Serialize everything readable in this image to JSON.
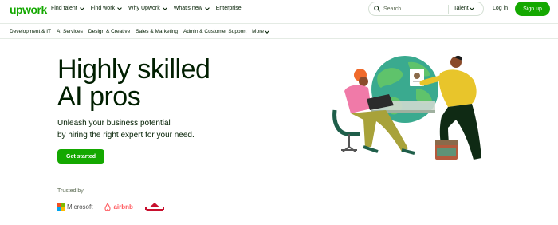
{
  "header": {
    "logo": "upwork",
    "nav": [
      {
        "label": "Find talent",
        "dropdown": true
      },
      {
        "label": "Find work",
        "dropdown": true
      },
      {
        "label": "Why Upwork",
        "dropdown": true
      },
      {
        "label": "What's new",
        "dropdown": true
      },
      {
        "label": "Enterprise",
        "dropdown": false
      }
    ],
    "search": {
      "placeholder": "Search",
      "filter": "Talent"
    },
    "login": "Log in",
    "signup": "Sign up"
  },
  "categories": [
    "Development & IT",
    "AI Services",
    "Design & Creative",
    "Sales & Marketing",
    "Admin & Customer Support"
  ],
  "categories_more": "More",
  "hero": {
    "title_line1": "Highly skilled",
    "title_line2": "AI pros",
    "subtitle_line1": "Unleash your business potential",
    "subtitle_line2": "by hiring the right expert for your need.",
    "cta": "Get started"
  },
  "trusted": {
    "label": "Trusted by",
    "microsoft": "Microsoft",
    "airbnb": "airbnb"
  },
  "colors": {
    "brand": "#14a800",
    "text": "#001e00",
    "muted": "#5e6d55"
  },
  "icons": {
    "search": "search-icon",
    "chevron": "chevron-down-icon"
  }
}
